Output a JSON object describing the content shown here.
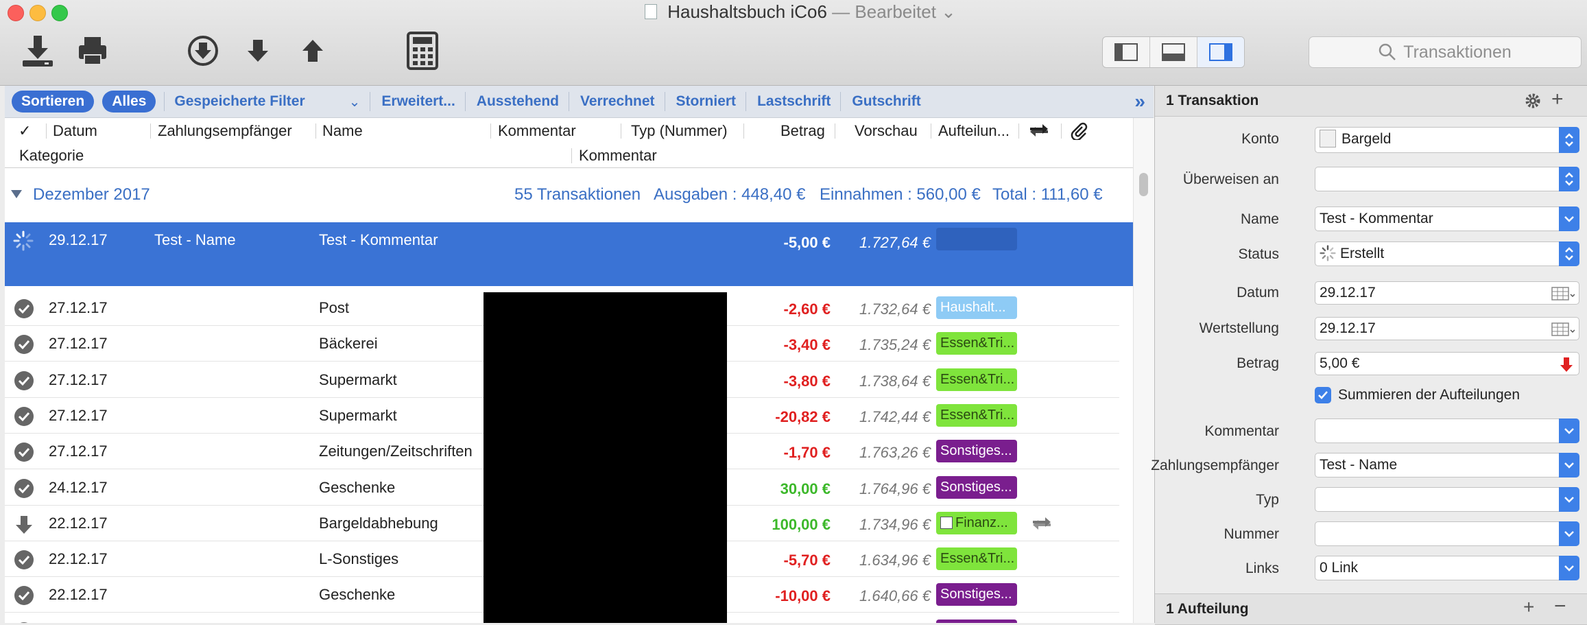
{
  "window": {
    "title": "Haushaltsbuch iCo6",
    "title_sep": "—",
    "subtitle": "Bearbeitet"
  },
  "toolbar": {
    "search_placeholder": "Transaktionen"
  },
  "filter": {
    "sort": "Sortieren",
    "all": "Alles",
    "saved": "Gespeicherte Filter",
    "advanced": "Erweitert...",
    "pending": "Ausstehend",
    "cleared": "Verrechnet",
    "voided": "Storniert",
    "debit": "Lastschrift",
    "credit": "Gutschrift"
  },
  "columns": {
    "check": "✓",
    "date": "Datum",
    "payee": "Zahlungsempfänger",
    "name": "Name",
    "comment": "Kommentar",
    "type": "Typ (Nummer)",
    "amount": "Betrag",
    "preview": "Vorschau",
    "split": "Aufteilun...",
    "category": "Kategorie",
    "comment2": "Kommentar"
  },
  "month": {
    "label": "Dezember 2017",
    "count": "55 Transaktionen",
    "expenses": "Ausgaben : 448,40 €",
    "income": "Einnahmen : 560,00 €",
    "total": "Total : 111,60 €"
  },
  "selected": {
    "date": "29.12.17",
    "payee": "Test - Name",
    "name": "Test - Kommentar",
    "amount": "-5,00 €",
    "preview": "1.727,64 €"
  },
  "rows": [
    {
      "status": "check",
      "date": "27.12.17",
      "name": "Post",
      "amount": "-2,60 €",
      "preview": "1.732,64 €",
      "tag": "Haushalt...",
      "tag_color": "#8ecbf5",
      "tag_text": "#ffffff",
      "sign": "neg"
    },
    {
      "status": "check",
      "date": "27.12.17",
      "name": "Bäckerei",
      "amount": "-3,40 €",
      "preview": "1.735,24 €",
      "tag": "Essen&Tri...",
      "tag_color": "#7fe43c",
      "tag_text": "#2b4a12",
      "sign": "neg"
    },
    {
      "status": "check",
      "date": "27.12.17",
      "name": "Supermarkt",
      "amount": "-3,80 €",
      "preview": "1.738,64 €",
      "tag": "Essen&Tri...",
      "tag_color": "#7fe43c",
      "tag_text": "#2b4a12",
      "sign": "neg"
    },
    {
      "status": "check",
      "date": "27.12.17",
      "name": "Supermarkt",
      "amount": "-20,82 €",
      "preview": "1.742,44 €",
      "tag": "Essen&Tri...",
      "tag_color": "#7fe43c",
      "tag_text": "#2b4a12",
      "sign": "neg"
    },
    {
      "status": "check",
      "date": "27.12.17",
      "name": "Zeitungen/Zeitschriften",
      "amount": "-1,70 €",
      "preview": "1.763,26 €",
      "tag": "Sonstiges...",
      "tag_color": "#7a1e8e",
      "tag_text": "#ffffff",
      "sign": "neg"
    },
    {
      "status": "check",
      "date": "24.12.17",
      "name": "Geschenke",
      "amount": "30,00 €",
      "preview": "1.764,96 €",
      "tag": "Sonstiges...",
      "tag_color": "#7a1e8e",
      "tag_text": "#ffffff",
      "sign": "pos"
    },
    {
      "status": "arrow",
      "date": "22.12.17",
      "name": "Bargeldabhebung",
      "amount": "100,00 €",
      "preview": "1.734,96 €",
      "tag": "Finanz...",
      "tag_color": "#7fe43c",
      "tag_text": "#2b4a12",
      "sign": "pos",
      "transfer": true
    },
    {
      "status": "check",
      "date": "22.12.17",
      "name": "L-Sonstiges",
      "amount": "-5,70 €",
      "preview": "1.634,96 €",
      "tag": "Essen&Tri...",
      "tag_color": "#7fe43c",
      "tag_text": "#2b4a12",
      "sign": "neg"
    },
    {
      "status": "check",
      "date": "22.12.17",
      "name": "Geschenke",
      "amount": "-10,00 €",
      "preview": "1.640,66 €",
      "tag": "Sonstiges...",
      "tag_color": "#7a1e8e",
      "tag_text": "#ffffff",
      "sign": "neg"
    },
    {
      "status": "check",
      "date": "",
      "name": "",
      "amount": "",
      "preview": "",
      "tag": "",
      "tag_color": "#7a1e8e",
      "tag_text": "#ffffff",
      "sign": "neg"
    }
  ],
  "inspector": {
    "header": "1 Transaktion",
    "account_label": "Konto",
    "account": "Bargeld",
    "transfer_label": "Überweisen an",
    "transfer": "",
    "name_label": "Name",
    "name": "Test - Kommentar",
    "status_label": "Status",
    "status": "Erstellt",
    "date_label": "Datum",
    "date": "29.12.17",
    "value_date_label": "Wertstellung",
    "value_date": "29.12.17",
    "amount_label": "Betrag",
    "amount": "5,00 €",
    "sum_splits": "Summieren der Aufteilungen",
    "comment_label": "Kommentar",
    "comment": "",
    "payee_label": "Zahlungsempfänger",
    "payee": "Test - Name",
    "type_label": "Typ",
    "type": "",
    "number_label": "Nummer",
    "number": "",
    "links_label": "Links",
    "links": "0 Link",
    "splits_header": "1 Aufteilung"
  },
  "colors": {
    "accent": "#3a73d5",
    "negative": "#e02020",
    "positive": "#3cb82a",
    "link": "#3a6fc4"
  }
}
